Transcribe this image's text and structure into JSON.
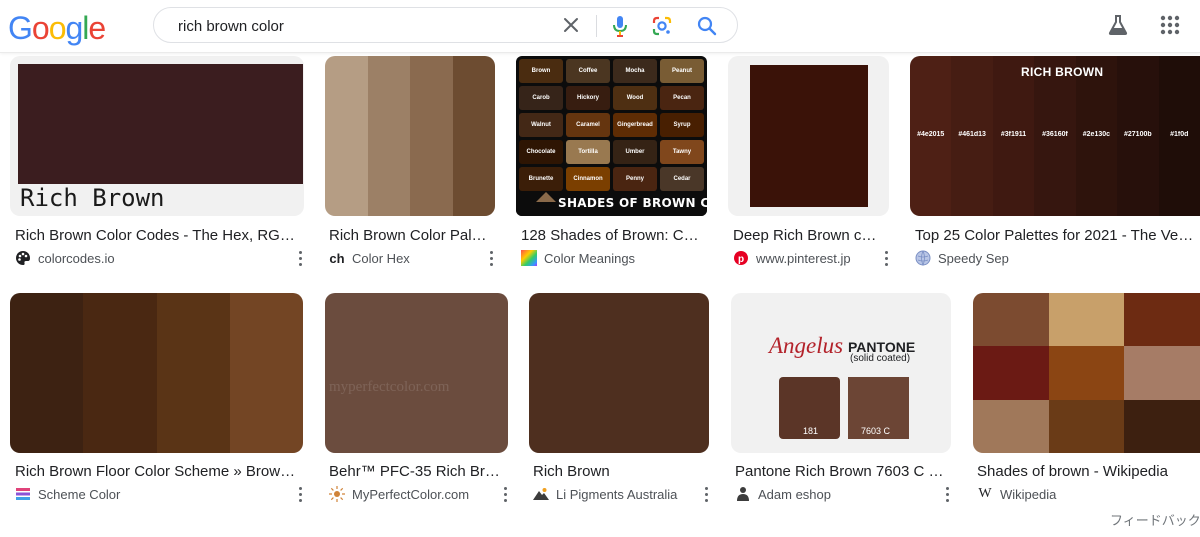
{
  "header": {
    "logo_letters": [
      {
        "ch": "G",
        "color": "#4285F4"
      },
      {
        "ch": "o",
        "color": "#EA4335"
      },
      {
        "ch": "o",
        "color": "#FBBC05"
      },
      {
        "ch": "g",
        "color": "#4285F4"
      },
      {
        "ch": "l",
        "color": "#34A853"
      },
      {
        "ch": "e",
        "color": "#EA4335"
      }
    ],
    "search_query": "rich brown color"
  },
  "results": [
    {
      "title": "Rich Brown Color Codes - The Hex, RG…",
      "source": "colorcodes.io",
      "thumb_text": "Rich Brown",
      "color": "#3b1d1f"
    },
    {
      "title": "Rich Brown Color Pal…",
      "source": "Color Hex",
      "stripes": [
        "#b59d84",
        "#9c8066",
        "#8a6a4f",
        "#6d4c31"
      ]
    },
    {
      "title": "128 Shades of Brown: C…",
      "source": "Color Meanings",
      "banner_text": "SHADES OF BROWN COLOR",
      "swatches": [
        {
          "name": "Brown",
          "color": "#4a2c10"
        },
        {
          "name": "Coffee",
          "color": "#4b3621"
        },
        {
          "name": "Mocha",
          "color": "#3c2a1c"
        },
        {
          "name": "Peanut",
          "color": "#795c34"
        },
        {
          "name": "Carob",
          "color": "#362419"
        },
        {
          "name": "Hickory",
          "color": "#371d10"
        },
        {
          "name": "Wood",
          "color": "#4e2f12"
        },
        {
          "name": "Pecan",
          "color": "#4a2511"
        },
        {
          "name": "Walnut",
          "color": "#432816"
        },
        {
          "name": "Caramel",
          "color": "#65350f"
        },
        {
          "name": "Gingerbread",
          "color": "#5e2c04"
        },
        {
          "name": "Syrup",
          "color": "#481f01"
        },
        {
          "name": "Chocolate",
          "color": "#2e1503"
        },
        {
          "name": "Tortilla",
          "color": "#997950"
        },
        {
          "name": "Umber",
          "color": "#352315"
        },
        {
          "name": "Tawny",
          "color": "#80471c"
        },
        {
          "name": "Brunette",
          "color": "#3b1e08"
        },
        {
          "name": "Cinnamon",
          "color": "#7b3f00"
        },
        {
          "name": "Penny",
          "color": "#4a2511"
        },
        {
          "name": "Cedar",
          "color": "#4a3728"
        }
      ]
    },
    {
      "title": "Deep Rich Brown c…",
      "source": "www.pinterest.jp",
      "color": "#3a1208"
    },
    {
      "title": "Top 25 Color Palettes for 2021 - The Ve…",
      "source": "Speedy Sep",
      "banner_text": "RICH BROWN",
      "palette": [
        {
          "code": "#4e2015",
          "color": "#4e2015"
        },
        {
          "code": "#461d13",
          "color": "#461d13"
        },
        {
          "code": "#3f1911",
          "color": "#3f1911"
        },
        {
          "code": "#36160f",
          "color": "#36160f"
        },
        {
          "code": "#2e130c",
          "color": "#2e130c"
        },
        {
          "code": "#27100b",
          "color": "#27100b"
        },
        {
          "code": "#1f0d",
          "color": "#1f0d08"
        }
      ]
    },
    {
      "title": "Rich Brown Floor Color Scheme » Brow…",
      "source": "Scheme Color",
      "stripes": [
        "#3d2212",
        "#4a2812",
        "#5a3416",
        "#734524"
      ]
    },
    {
      "title": "Behr™ PFC-35 Rich Br…",
      "source": "MyPerfectColor.com",
      "watermark": "myperfectcolor.com",
      "color": "#6b4c3e"
    },
    {
      "title": "Rich Brown",
      "source": "Li Pigments Australia",
      "color": "#4e2f1f"
    },
    {
      "title": "Pantone Rich Brown 7603 C …",
      "source": "Adam eshop",
      "brand_left": "Angelus",
      "brand_right": "PANTONE",
      "brand_right_sub": "(solid coated)",
      "code_left": "181",
      "code_right": "7603 C",
      "color_left": "#5b3527",
      "color_right": "#6c4535"
    },
    {
      "title": "Shades of brown - Wikipedia",
      "source": "Wikipedia",
      "grid": [
        "#7c4b30",
        "#c8a06a",
        "#6d2b12",
        "#6b1a14",
        "#8b4513",
        "#a67c66",
        "#a0785a",
        "#6a3b17",
        "#3d2010"
      ]
    }
  ],
  "footer": {
    "feedback": "フィードバック"
  }
}
